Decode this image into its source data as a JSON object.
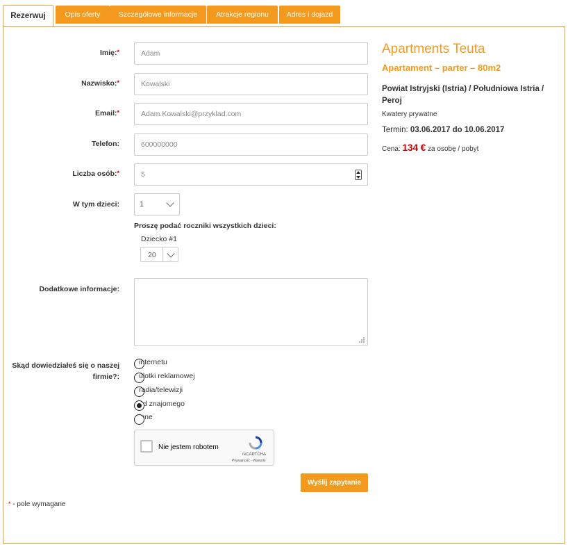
{
  "tabs": [
    {
      "label": "Rezerwuj",
      "active": true
    },
    {
      "label": "Opis oferty"
    },
    {
      "label": "Szczegółowe informacje"
    },
    {
      "label": "Atrakcje regionu"
    },
    {
      "label": "Adres i dojazd"
    }
  ],
  "form": {
    "first_name": {
      "label": "Imię:",
      "required": "*",
      "value": "Adam"
    },
    "last_name": {
      "label": "Nazwisko:",
      "required": "*",
      "value": "Kowalski"
    },
    "email": {
      "label": "Email:",
      "required": "*",
      "value": "Adam.Kowalski@przyklad.com"
    },
    "phone": {
      "label": "Telefon:",
      "value": "600000000"
    },
    "persons": {
      "label": "Liczba osób:",
      "required": "*",
      "value": "5"
    },
    "children": {
      "label": "W tym dzieci:",
      "value": "1"
    },
    "children_years_prompt": "Proszę podać roczniki wszystkich dzieci:",
    "child1": {
      "label": "Dziecko #1",
      "value": "20"
    },
    "additional": {
      "label": "Dodatkowe informacje:",
      "value": ""
    },
    "source": {
      "label": "Skąd dowiedziałeś się o naszej firmie?:",
      "options": [
        {
          "label": "internetu",
          "selected": false
        },
        {
          "label": "ulotki reklamowej",
          "selected": false
        },
        {
          "label": "radia/telewizji",
          "selected": false
        },
        {
          "label": "od znajomego",
          "selected": true
        },
        {
          "label": "inne",
          "selected": false
        }
      ]
    },
    "captcha": {
      "label": "Nie jestem robotem",
      "brand": "reCAPTCHA",
      "terms": "Prywatność - Warunki"
    },
    "submit_label": "Wyślij zapytanie",
    "required_note": "- pole wymagane",
    "required_mark": "*"
  },
  "offer": {
    "title": "Apartments Teuta",
    "subtitle": "Apartament – parter – 80m2",
    "region": "Powiat Istryjski (Istria) / Południowa Istria / Peroj",
    "type": "Kwatery prywatne",
    "term_label": "Termin:",
    "term_value": "03.06.2017 do 10.06.2017",
    "price_label": "Cena:",
    "price_value": "134 €",
    "price_unit": "za osobę / pobyt"
  },
  "colors": {
    "accent": "#f39a1e",
    "price": "#cc0000"
  }
}
